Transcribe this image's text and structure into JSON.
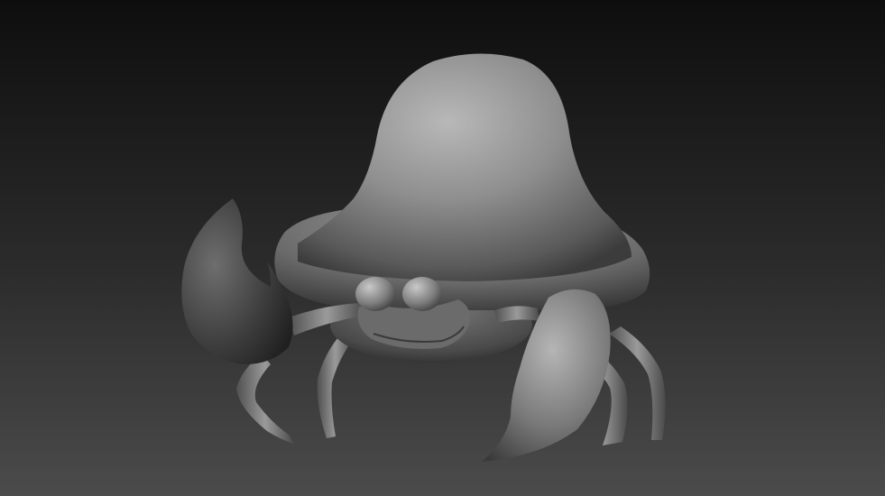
{
  "viewport": {
    "background_top": "#101010",
    "background_bottom": "#4a4a4a",
    "material_light": "#bdbdbd",
    "material_mid": "#7e7e7e",
    "material_dark": "#2a2a2a"
  },
  "model": {
    "subject": "crab-sculpt"
  }
}
